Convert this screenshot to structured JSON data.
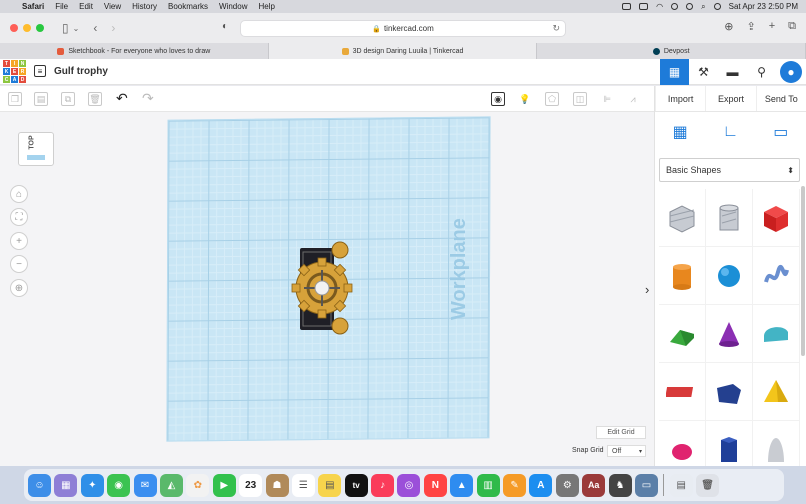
{
  "menubar": {
    "app_name": "Safari",
    "items": [
      "File",
      "Edit",
      "View",
      "History",
      "Bookmarks",
      "Window",
      "Help"
    ],
    "datetime": "Sat Apr 23  2:50 PM"
  },
  "browser": {
    "address": "tinkercad.com",
    "tabs": [
      {
        "label": "Sketchbook - For everyone who loves to draw",
        "color": "#e45b3c"
      },
      {
        "label": "3D design Daring Luuila | Tinkercad",
        "color": "#e9a93b"
      },
      {
        "label": "Devpost",
        "color": "#003e54"
      }
    ]
  },
  "header": {
    "logo_letters": [
      "T",
      "I",
      "N",
      "K",
      "E",
      "R",
      "C",
      "A",
      "D"
    ],
    "design_title": "Gulf trophy"
  },
  "actions": {
    "import_label": "Import",
    "export_label": "Export",
    "send_label": "Send To"
  },
  "shapes_panel": {
    "category": "Basic Shapes"
  },
  "viewcube": {
    "face_label": "TOP"
  },
  "workplane": {
    "label": "Workplane"
  },
  "grid": {
    "edit_label": "Edit Grid",
    "snap_label": "Snap Grid",
    "snap_value": "Off"
  },
  "dock": {
    "calendar_day": "23"
  },
  "colors": {
    "accent": "#1e7bd9",
    "workplane": "#c9e6f5"
  }
}
